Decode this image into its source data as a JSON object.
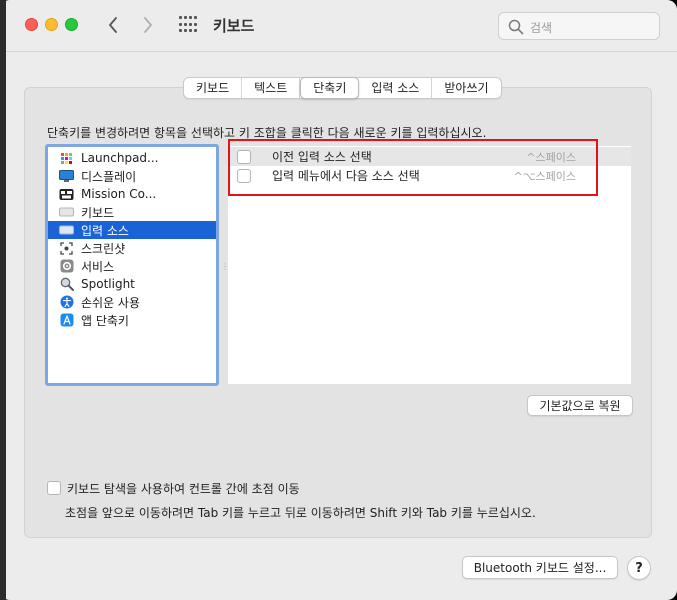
{
  "window": {
    "title": "키보드",
    "search_placeholder": "검색"
  },
  "tabs": [
    {
      "label": "키보드"
    },
    {
      "label": "텍스트"
    },
    {
      "label": "단축키",
      "selected": true
    },
    {
      "label": "입력 소스"
    },
    {
      "label": "받아쓰기"
    }
  ],
  "instruction": "단축키를 변경하려면 항목을 선택하고 키 조합을 클릭한 다음 새로운 키를 입력하십시오.",
  "sidebar": {
    "items": [
      {
        "label": "Launchpad...",
        "icon": "launchpad-icon"
      },
      {
        "label": "디스플레이",
        "icon": "display-icon"
      },
      {
        "label": "Mission Co...",
        "icon": "mission-control-icon"
      },
      {
        "label": "키보드",
        "icon": "keyboard-icon"
      },
      {
        "label": "입력 소스",
        "icon": "input-source-icon",
        "selected": true
      },
      {
        "label": "스크린샷",
        "icon": "screenshot-icon"
      },
      {
        "label": "서비스",
        "icon": "services-gear-icon"
      },
      {
        "label": "Spotlight",
        "icon": "spotlight-magnifier-icon"
      },
      {
        "label": "손쉬운 사용",
        "icon": "accessibility-icon"
      },
      {
        "label": "앱 단축키",
        "icon": "app-shortcuts-icon"
      }
    ]
  },
  "shortcuts": [
    {
      "label": "이전 입력 소스 선택",
      "keys": "^스페이스",
      "checked": false
    },
    {
      "label": "입력 메뉴에서 다음 소스 선택",
      "keys": "^⌥스페이스",
      "checked": false
    }
  ],
  "buttons": {
    "restore_defaults": "기본값으로 복원",
    "bluetooth": "Bluetooth 키보드 설정...",
    "help": "?"
  },
  "keyboard_navigation": {
    "label": "키보드 탐색을 사용하여 컨트롤 간에 초점 이동",
    "hint": "초점을 앞으로 이동하려면 Tab 키를 누르고 뒤로 이동하려면 Shift 키와 Tab 키를 누르십시오.",
    "checked": false
  },
  "colors": {
    "selection": "#1a63d6",
    "highlight_box": "#e0141a",
    "sidebar_focus": "#7ea6e0"
  }
}
